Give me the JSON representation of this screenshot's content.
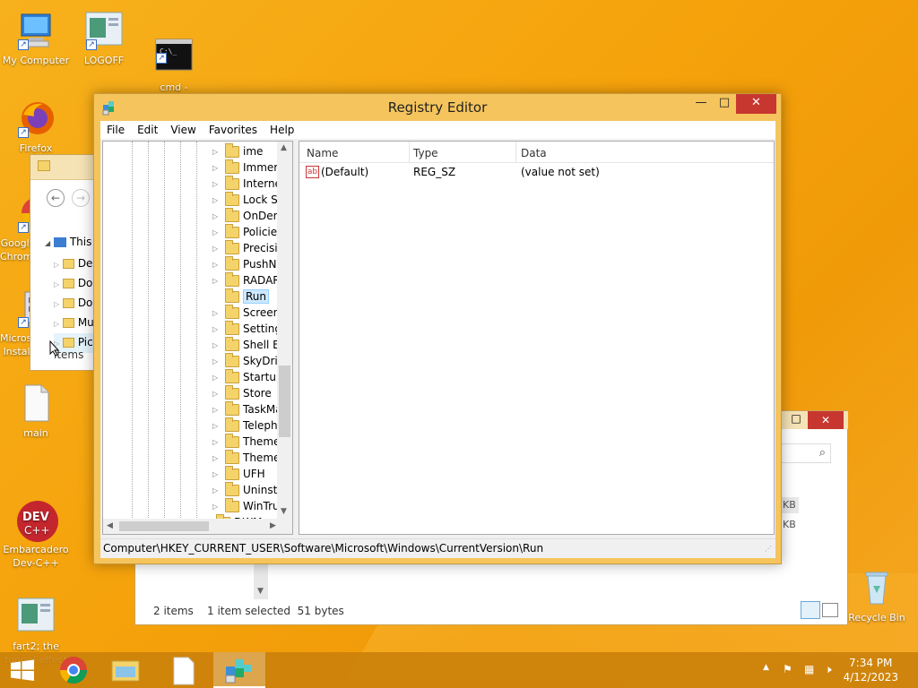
{
  "desktop": {
    "icons": [
      {
        "label": "My Computer"
      },
      {
        "label": "LOGOFF"
      },
      {
        "label": "cmd -\nShortcut"
      },
      {
        "label": "Firefox"
      },
      {
        "label": "Google Chrome"
      },
      {
        "label": "Microsoft Install"
      },
      {
        "label": "main"
      },
      {
        "label": "Embarcadero\nDev-C++"
      },
      {
        "label": "fart2; the\ntunnel effect"
      },
      {
        "label": "Recycle Bin"
      }
    ]
  },
  "explorer_back": {
    "tree_root": "This",
    "items": [
      "De",
      "Do",
      "Do",
      "Mu",
      "Pic"
    ],
    "status": "items"
  },
  "explorer_front": {
    "status_items": "2 items",
    "status_selected": "1 item selected  51 bytes",
    "sizes": [
      "KB",
      "KB"
    ]
  },
  "regedit": {
    "title": "Registry Editor",
    "menu": [
      "File",
      "Edit",
      "View",
      "Favorites",
      "Help"
    ],
    "tree": [
      {
        "label": "ime",
        "selected": false
      },
      {
        "label": "Immers",
        "selected": false
      },
      {
        "label": "Interne",
        "selected": false
      },
      {
        "label": "Lock Sc",
        "selected": false
      },
      {
        "label": "OnDem",
        "selected": false
      },
      {
        "label": "Policies",
        "selected": false
      },
      {
        "label": "Precisic",
        "selected": false
      },
      {
        "label": "PushNo",
        "selected": false
      },
      {
        "label": "RADAR",
        "selected": false
      },
      {
        "label": "Run",
        "selected": true
      },
      {
        "label": "Screens",
        "selected": false
      },
      {
        "label": "Setting",
        "selected": false
      },
      {
        "label": "Shell Ex",
        "selected": false
      },
      {
        "label": "SkyDriv",
        "selected": false
      },
      {
        "label": "Startup",
        "selected": false
      },
      {
        "label": "Store",
        "selected": false
      },
      {
        "label": "TaskMa",
        "selected": false
      },
      {
        "label": "Telepho",
        "selected": false
      },
      {
        "label": "Theme",
        "selected": false
      },
      {
        "label": "Theme",
        "selected": false
      },
      {
        "label": "UFH",
        "selected": false
      },
      {
        "label": "Uninsta",
        "selected": false
      },
      {
        "label": "WinTru",
        "selected": false
      },
      {
        "label": "DWM",
        "selected": false
      }
    ],
    "columns": {
      "name": "Name",
      "type": "Type",
      "data": "Data"
    },
    "values": [
      {
        "icon": "ab",
        "name": "(Default)",
        "type": "REG_SZ",
        "data": "(value not set)"
      }
    ],
    "status_path": "Computer\\HKEY_CURRENT_USER\\Software\\Microsoft\\Windows\\CurrentVersion\\Run"
  },
  "taskbar": {
    "time": "7:34 PM",
    "date": "4/12/2023"
  }
}
